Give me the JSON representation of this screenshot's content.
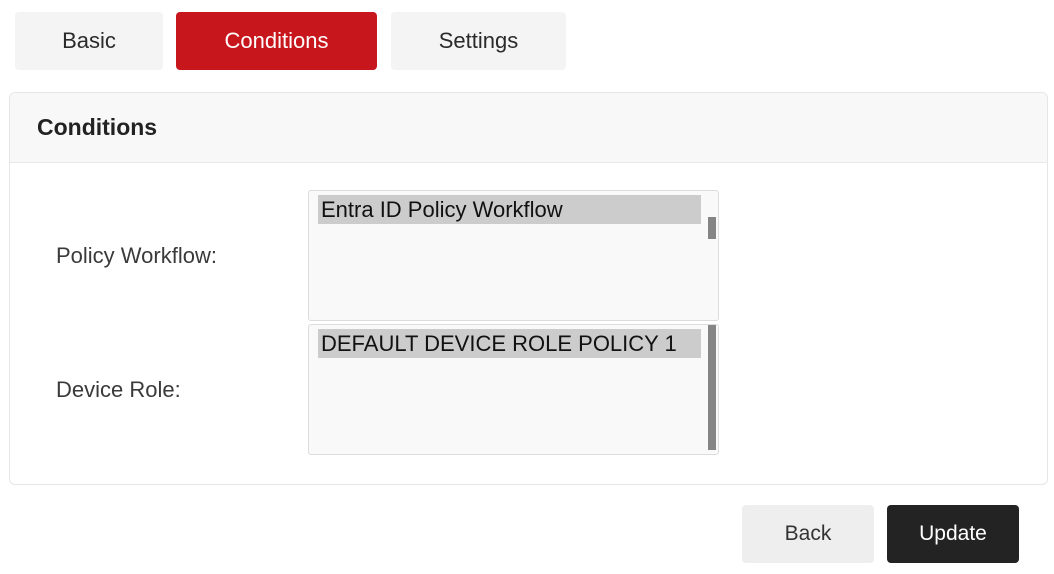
{
  "tabs": [
    {
      "label": "Basic",
      "active": false
    },
    {
      "label": "Conditions",
      "active": true
    },
    {
      "label": "Settings",
      "active": false
    }
  ],
  "panel": {
    "title": "Conditions",
    "fields": {
      "policy_workflow": {
        "label": "Policy Workflow:",
        "options": [
          "Entra ID Policy Workflow"
        ],
        "selected": "Entra ID Policy Workflow"
      },
      "device_role": {
        "label": "Device Role:",
        "options": [
          "DEFAULT DEVICE ROLE POLICY 1"
        ],
        "selected": "DEFAULT DEVICE ROLE POLICY 1"
      }
    }
  },
  "actions": {
    "back_label": "Back",
    "update_label": "Update"
  },
  "colors": {
    "accent": "#c8161d",
    "primary_button": "#232323",
    "selected_option": "#cccccc"
  }
}
